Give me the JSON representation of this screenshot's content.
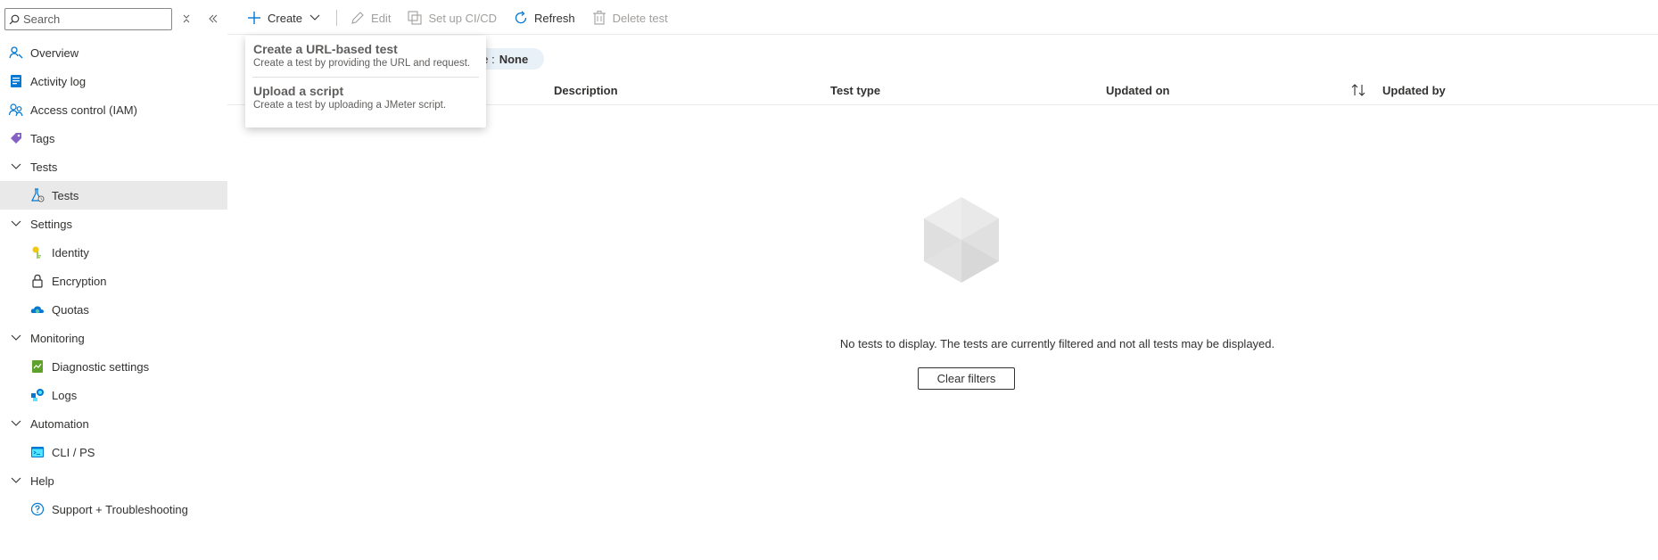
{
  "sidebar": {
    "search_placeholder": "Search",
    "items": [
      {
        "label": "Overview",
        "icon": "overview-icon"
      },
      {
        "label": "Activity log",
        "icon": "activity-log-icon"
      },
      {
        "label": "Access control (IAM)",
        "icon": "iam-icon"
      },
      {
        "label": "Tags",
        "icon": "tags-icon"
      },
      {
        "label": "Tests",
        "icon": "chevron-down-icon",
        "group": true
      },
      {
        "label": "Tests",
        "icon": "test-flask-icon",
        "active": true
      },
      {
        "label": "Settings",
        "icon": "chevron-down-icon",
        "group": true
      },
      {
        "label": "Identity",
        "icon": "identity-key-icon"
      },
      {
        "label": "Encryption",
        "icon": "lock-icon"
      },
      {
        "label": "Quotas",
        "icon": "quotas-cloud-icon"
      },
      {
        "label": "Monitoring",
        "icon": "chevron-down-icon",
        "group": true
      },
      {
        "label": "Diagnostic settings",
        "icon": "diagnostic-icon"
      },
      {
        "label": "Logs",
        "icon": "logs-icon"
      },
      {
        "label": "Automation",
        "icon": "chevron-down-icon",
        "group": true
      },
      {
        "label": "CLI / PS",
        "icon": "cli-icon"
      },
      {
        "label": "Help",
        "icon": "chevron-down-icon",
        "group": true
      },
      {
        "label": "Support + Troubleshooting",
        "icon": "help-circle-icon"
      }
    ]
  },
  "toolbar": {
    "create": "Create",
    "edit": "Edit",
    "setup_cicd": "Set up CI/CD",
    "refresh": "Refresh",
    "delete": "Delete test"
  },
  "filter_pill": {
    "label": "ge :",
    "value": "None"
  },
  "table": {
    "columns": [
      "Description",
      "Test type",
      "Updated on",
      "Updated by"
    ]
  },
  "empty_state": {
    "message": "No tests to display. The tests are currently filtered and not all tests may be displayed.",
    "clear_button": "Clear filters"
  },
  "create_menu": {
    "items": [
      {
        "title": "Create a URL-based test",
        "desc": "Create a test by providing the URL and request."
      },
      {
        "title": "Upload a script",
        "desc": "Create a test by uploading a JMeter script."
      }
    ]
  },
  "colors": {
    "accent": "#0078d4",
    "active_bg": "#e9e9e9",
    "pill_bg": "#e8f0f8"
  }
}
